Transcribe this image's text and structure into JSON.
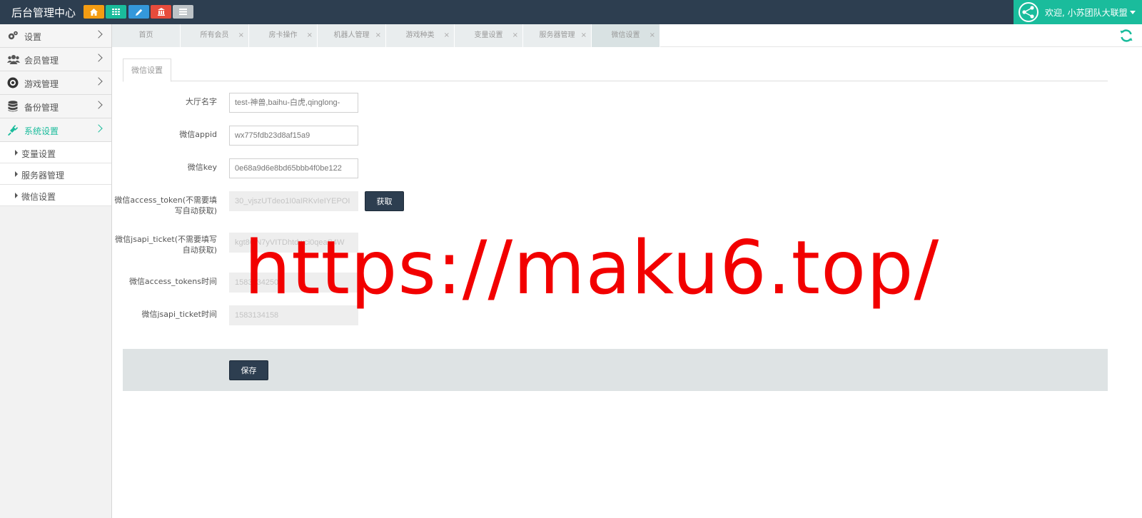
{
  "header": {
    "title": "后台管理中心",
    "quick_buttons": [
      {
        "name": "home-icon",
        "color": "#f39c12"
      },
      {
        "name": "grid-icon",
        "color": "#1abc9c"
      },
      {
        "name": "pencil-icon",
        "color": "#3498db"
      },
      {
        "name": "bank-icon",
        "color": "#e74c3c"
      },
      {
        "name": "list-icon",
        "color": "#bdc3c7"
      }
    ],
    "user": {
      "greeting": "欢迎, 小苏团队大联盟"
    }
  },
  "colors": {
    "accent": "#1abc9c",
    "navbar": "#2d3e50",
    "watermark": "#f20000"
  },
  "sidebar": {
    "items": [
      {
        "label": "设置",
        "icon": "gears-icon"
      },
      {
        "label": "会员管理",
        "icon": "users-icon"
      },
      {
        "label": "游戏管理",
        "icon": "soccer-ball-icon"
      },
      {
        "label": "备份管理",
        "icon": "database-icon"
      },
      {
        "label": "系统设置",
        "icon": "plug-icon",
        "active": true
      }
    ],
    "subitems": [
      {
        "label": "变量设置"
      },
      {
        "label": "服务器管理"
      },
      {
        "label": "微信设置"
      }
    ]
  },
  "tabs": [
    {
      "label": "首页",
      "closable": false
    },
    {
      "label": "所有会员",
      "closable": true
    },
    {
      "label": "房卡操作",
      "closable": true
    },
    {
      "label": "机器人管理",
      "closable": true
    },
    {
      "label": "游戏种类",
      "closable": true
    },
    {
      "label": "变量设置",
      "closable": true
    },
    {
      "label": "服务器管理",
      "closable": true
    },
    {
      "label": "微信设置",
      "closable": true,
      "active": true
    }
  ],
  "tab_close_glyph": "×",
  "form": {
    "section_tab": "微信设置",
    "fields": [
      {
        "label": "大厅名字",
        "value": "test-神兽,baihu-白虎,qinglong-"
      },
      {
        "label": "微信appid",
        "value": "wx775fdb23d8af15a9"
      },
      {
        "label": "微信key",
        "value": "0e68a9d6e8bd65bbb4f0be122"
      },
      {
        "label": "微信access_token(不需要填写自动获取)",
        "value": "30_vjszUTdeo1I0aIRKvIeIYEPOI",
        "readonly": true
      },
      {
        "label": "微信jsapi_ticket(不需要填写自动获取)",
        "value": "kgt8GN7yVITDhtdwci0qeaS4W",
        "readonly": true
      },
      {
        "label": "微信access_tokens时间",
        "value": "1583134250",
        "readonly": true
      },
      {
        "label": "微信jsapi_ticket时间",
        "value": "1583134158",
        "readonly": true
      }
    ],
    "fetch_button": "获取",
    "save_button": "保存"
  },
  "watermark": "https://maku6.top/"
}
